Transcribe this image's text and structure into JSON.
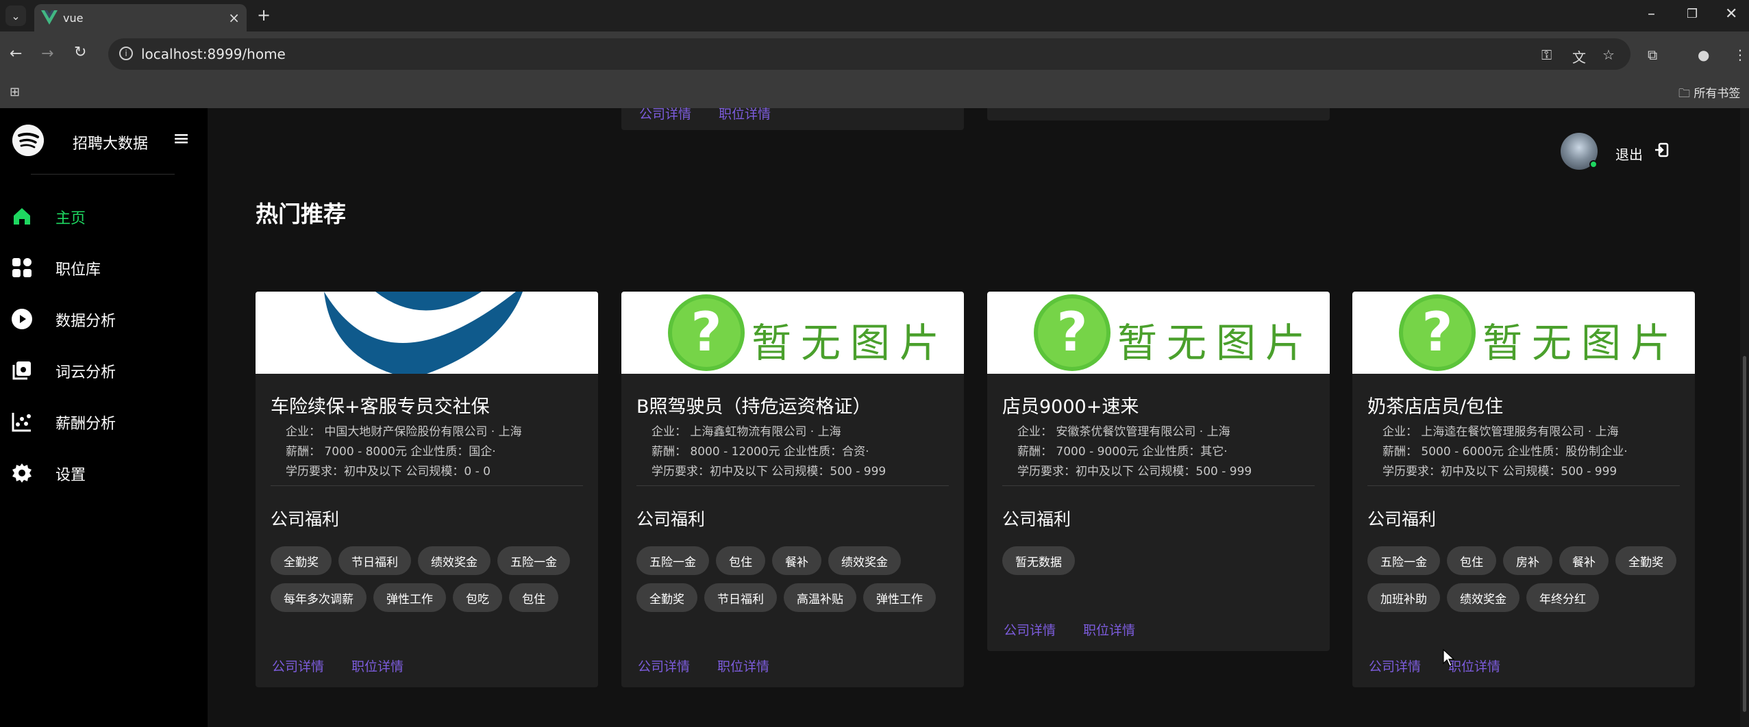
{
  "browser": {
    "tab_title": "vue",
    "url": "localhost:8999/home",
    "bookmarks_all": "所有书签"
  },
  "brand": {
    "name": "招聘大数据"
  },
  "menu": [
    {
      "label": "主页",
      "icon": "home-icon",
      "active": true
    },
    {
      "label": "职位库",
      "icon": "grid-icon",
      "active": false
    },
    {
      "label": "数据分析",
      "icon": "play-circle-icon",
      "active": false
    },
    {
      "label": "词云分析",
      "icon": "library-icon",
      "active": false
    },
    {
      "label": "薪酬分析",
      "icon": "scatter-chart-icon",
      "active": false
    },
    {
      "label": "设置",
      "icon": "gear-icon",
      "active": false
    }
  ],
  "user": {
    "logout_label": "退出"
  },
  "section_title": "热门推荐",
  "links": {
    "company_detail": "公司详情",
    "job_detail": "职位详情"
  },
  "no_image_text": "暂无图片",
  "cards": [
    {
      "title": "车险续保+客服专员交社保",
      "company_line": "企业： 中国大地财产保险股份有限公司 · 上海",
      "salary_line": "薪酬： 7000 - 8000元 企业性质：国企·",
      "edu_line": "学历要求：初中及以下 公司规模：0 - 0",
      "welfare_title": "公司福利",
      "tags": [
        "全勤奖",
        "节日福利",
        "绩效奖金",
        "五险一金",
        "每年多次调薪",
        "弹性工作",
        "包吃",
        "包住"
      ]
    },
    {
      "title": "B照驾驶员（持危运资格证）",
      "company_line": "企业： 上海鑫虹物流有限公司 · 上海",
      "salary_line": "薪酬： 8000 - 12000元 企业性质：合资·",
      "edu_line": "学历要求：初中及以下 公司规模：500 - 999",
      "welfare_title": "公司福利",
      "tags": [
        "五险一金",
        "包住",
        "餐补",
        "绩效奖金",
        "全勤奖",
        "节日福利",
        "高温补贴",
        "弹性工作"
      ]
    },
    {
      "title": "店员9000+速来",
      "company_line": "企业： 安徽茶优餐饮管理有限公司 · 上海",
      "salary_line": "薪酬： 7000 - 9000元 企业性质：其它·",
      "edu_line": "学历要求：初中及以下 公司规模：500 - 999",
      "welfare_title": "公司福利",
      "tags": [
        "暂无数据"
      ]
    },
    {
      "title": "奶茶店店员/包住",
      "company_line": "企业： 上海逵在餐饮管理服务有限公司 · 上海",
      "salary_line": "薪酬： 5000 - 6000元 企业性质：股份制企业·",
      "edu_line": "学历要求：初中及以下 公司规模：500 - 999",
      "welfare_title": "公司福利",
      "tags": [
        "五险一金",
        "包住",
        "房补",
        "餐补",
        "全勤奖",
        "加班补助",
        "绩效奖金",
        "年终分红"
      ]
    }
  ],
  "colors": {
    "accent_green": "#1ed760",
    "link_purple": "#7c5cdc",
    "card_bg": "#202020"
  }
}
